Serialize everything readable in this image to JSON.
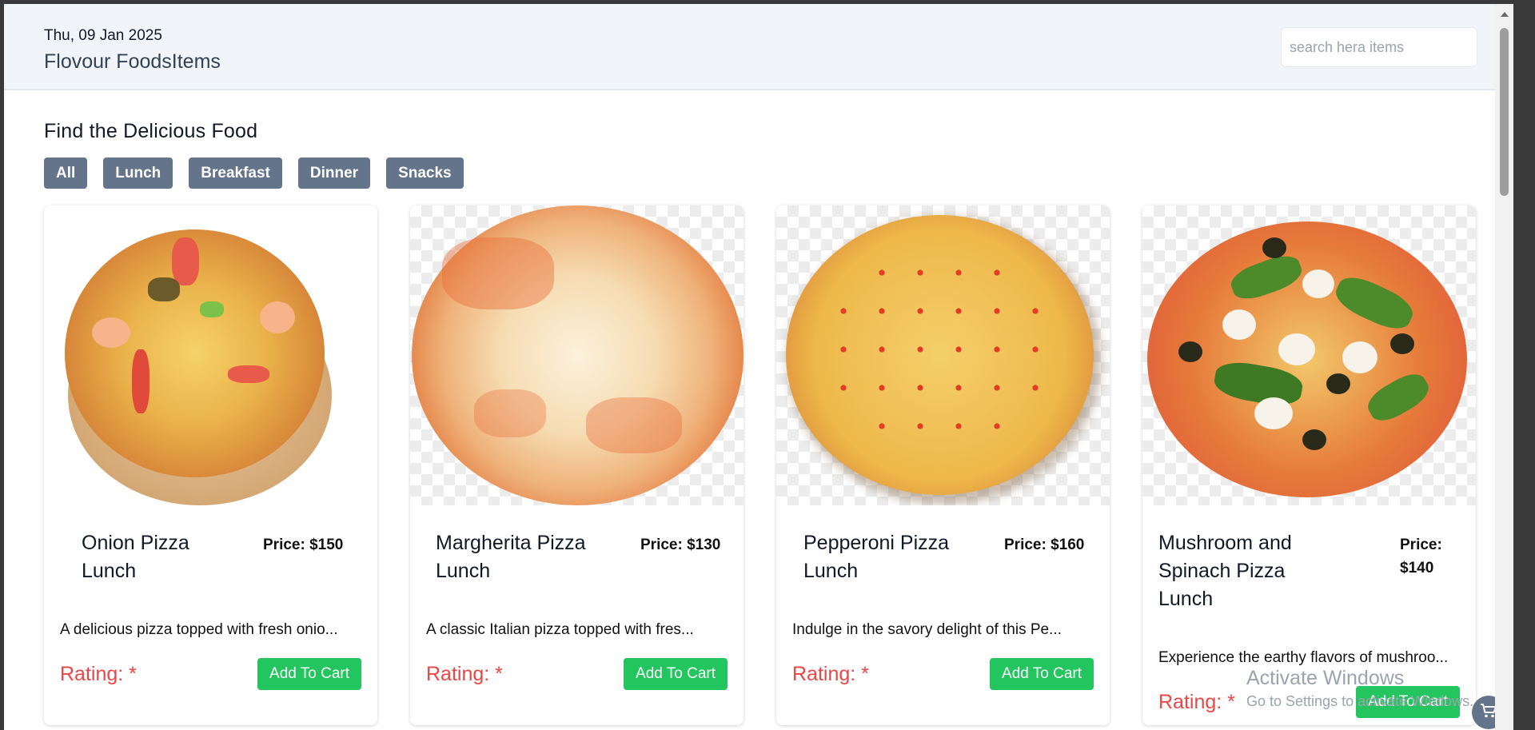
{
  "header": {
    "date": "Thu, 09 Jan 2025",
    "brand": "Flovour FoodsItems",
    "search_placeholder": "search hera items"
  },
  "main": {
    "title": "Find the Delicious Food",
    "filters": [
      "All",
      "Lunch",
      "Breakfast",
      "Dinner",
      "Snacks"
    ]
  },
  "cards": [
    {
      "name_line1": "Onion Pizza",
      "name_line2": "Lunch",
      "price": "Price: $150",
      "description": "A delicious pizza topped with fresh onio...",
      "rating": "Rating: *",
      "button": "Add To Cart"
    },
    {
      "name_line1": "Margherita Pizza",
      "name_line2": "Lunch",
      "price": "Price: $130",
      "description": "A classic Italian pizza topped with fres...",
      "rating": "Rating: *",
      "button": "Add To Cart"
    },
    {
      "name_line1": "Pepperoni Pizza",
      "name_line2": "Lunch",
      "price": "Price: $160",
      "description": "Indulge in the savory delight of this Pe...",
      "rating": "Rating: *",
      "button": "Add To Cart"
    },
    {
      "name_line1": "Mushroom and",
      "name_line2": "Spinach Pizza",
      "name_line3": "Lunch",
      "price_line1": "Price:",
      "price_line2": "$140",
      "description": "Experience the earthy flavors of mushroo...",
      "rating": "Rating: *",
      "button": "Add To Cart"
    }
  ],
  "watermark": {
    "line1": "Activate Windows",
    "line2": "Go to Settings to activate Windows."
  },
  "colors": {
    "accent_green": "#22c55e",
    "filter_gray": "#64748b",
    "rating_red": "#ef4444",
    "header_bg": "#f1f5f9"
  },
  "icons": {
    "chat_button": "cart-icon"
  }
}
